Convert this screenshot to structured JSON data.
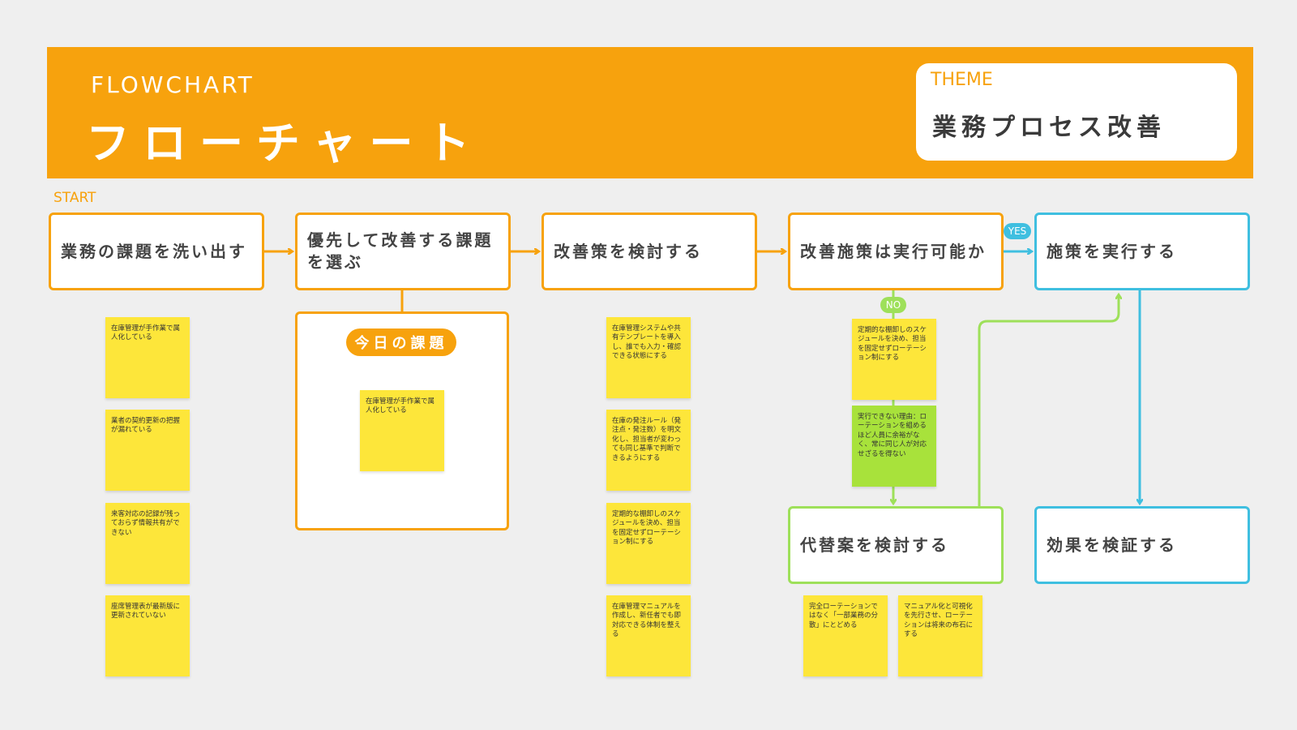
{
  "header": {
    "subtitle": "FLOWCHART",
    "title": "フローチャート",
    "theme_label": "THEME",
    "theme_value": "業務プロセス改善"
  },
  "start_label": "START",
  "nodes": {
    "identify": "業務の課題を洗い出す",
    "prioritize": "優先して改善する課題を選ぶ",
    "consider": "改善策を検討する",
    "feasible": "改善施策は実行可能か",
    "execute": "施策を実行する",
    "alternative": "代替案を検討する",
    "verify": "効果を検証する"
  },
  "panel_tag": "今日の課題",
  "branch_labels": {
    "yes": "YES",
    "no": "NO"
  },
  "notes": {
    "issues": [
      "在庫管理が手作業で属人化している",
      "業者の契約更新の把握が漏れている",
      "来客対応の記録が残っておらず情報共有ができない",
      "座席管理表が最新版に更新されていない"
    ],
    "today": "在庫管理が手作業で属人化している",
    "measures": [
      "在庫管理システムや共有テンプレートを導入し、誰でも入力・確認できる状態にする",
      "在庫の発注ルール（発注点・発注数）を明文化し、担当者が変わっても同じ基準で判断できるようにする",
      "定期的な棚卸しのスケジュールを決め、担当を固定せずローテーション制にする",
      "在庫管理マニュアルを作成し、新任者でも即対応できる体制を整える"
    ],
    "no_branch": "定期的な棚卸しのスケジュールを決め、担当を固定せずローテーション制にする",
    "reason": "実行できない理由：ローテーションを組めるほど人員に余裕がなく、常に同じ人が対応せざるを得ない",
    "alternatives": [
      "完全ローテーションではなく「一部業務の分散」にとどめる",
      "マニュアル化と可視化を先行させ、ローテーションは将来の布石にする"
    ]
  },
  "colors": {
    "orange": "#f7a20d",
    "blue": "#3fbfe0",
    "green": "#9ee05a",
    "note_yellow": "#fde63a",
    "note_green": "#a8e23b"
  }
}
